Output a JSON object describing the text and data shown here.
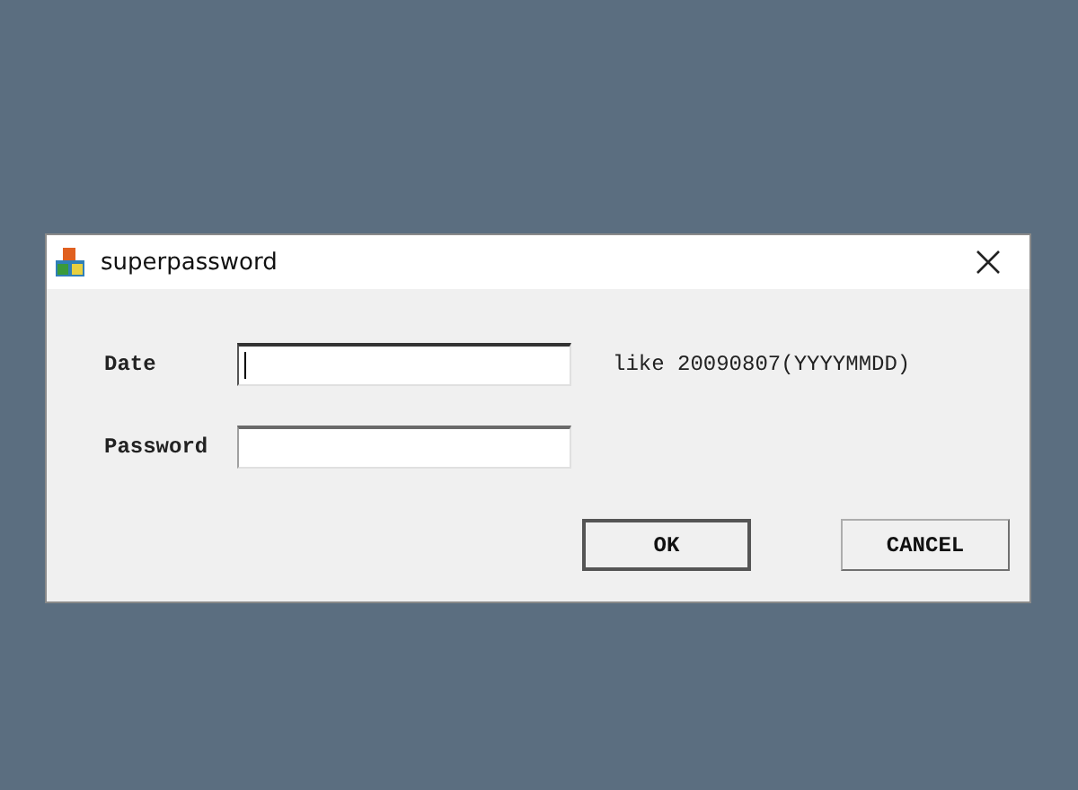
{
  "window": {
    "title": "superpassword"
  },
  "fields": [
    {
      "label": "Date",
      "focused": true,
      "hint": "like 20090807(YYYYMMDD)"
    },
    {
      "label": "Password",
      "focused": false
    }
  ],
  "buttons": [
    {
      "label": "OK",
      "default": true
    },
    {
      "label": "CANCEL",
      "default": false
    }
  ]
}
